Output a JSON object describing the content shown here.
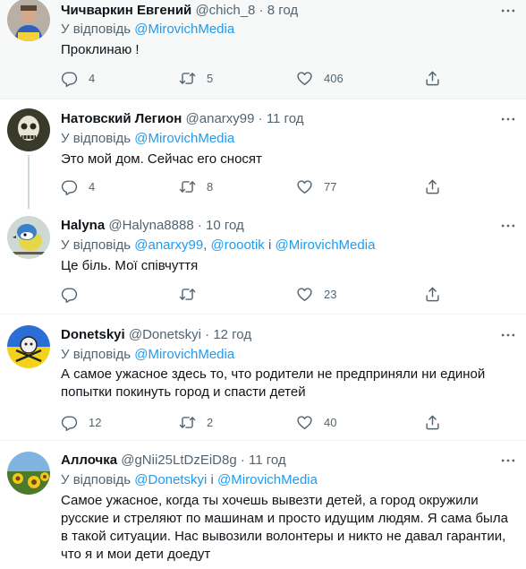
{
  "tweets": [
    {
      "name": "Чичваркин Евгений",
      "handle": "@chich_8",
      "sep": "·",
      "time": "8 год",
      "reply_prefix": "У відповідь",
      "mentions": [
        "@MirovichMedia"
      ],
      "text": "Проклинаю !",
      "replies": "4",
      "retweets": "5",
      "likes": "406"
    },
    {
      "name": "Натовский Легион",
      "handle": "@anarxy99",
      "sep": "·",
      "time": "11 год",
      "reply_prefix": "У відповідь",
      "mentions": [
        "@MirovichMedia"
      ],
      "text": "Это мой дом. Сейчас его сносят",
      "replies": "4",
      "retweets": "8",
      "likes": "77"
    },
    {
      "name": "Halyna",
      "handle": "@Halyna8888",
      "sep": "·",
      "time": "10 год",
      "reply_prefix": "У відповідь",
      "mentions": [
        "@anarxy99",
        "@roootik",
        "@MirovichMedia"
      ],
      "mention_sep": ",",
      "mention_and": "і",
      "text": "Це біль. Мої співчуття",
      "replies": "",
      "retweets": "",
      "likes": "23"
    },
    {
      "name": "Donetskyi",
      "handle": "@Donetskyi",
      "sep": "·",
      "time": "12 год",
      "reply_prefix": "У відповідь",
      "mentions": [
        "@MirovichMedia"
      ],
      "text": "А самое ужасное здесь то, что родители не предприняли ни единой попытки покинуть город и спасти детей",
      "replies": "12",
      "retweets": "2",
      "likes": "40"
    },
    {
      "name": "Аллочка",
      "handle": "@gNii25LtDzEiD8g",
      "sep": "·",
      "time": "11 год",
      "reply_prefix": "У відповідь",
      "mentions": [
        "@Donetskyi",
        "@MirovichMedia"
      ],
      "mention_and": "і",
      "text": "Самое ужасное, когда ты хочешь вывезти детей, а город окружили русские и стреляют по машинам и просто идущим людям. Я сама была в такой ситуации. Нас вывозили волонтеры и никто не давал гарантии, что я и мои дети доедут"
    }
  ],
  "colors": {
    "text": "#0f1419",
    "secondary": "#536471",
    "link": "#1d9bf0",
    "highlight_bg": "#f7f9f9",
    "divider": "#eff3f4"
  },
  "icons": {
    "reply": "reply-icon",
    "retweet": "retweet-icon",
    "like": "like-icon",
    "share": "share-icon",
    "more": "more-icon"
  }
}
